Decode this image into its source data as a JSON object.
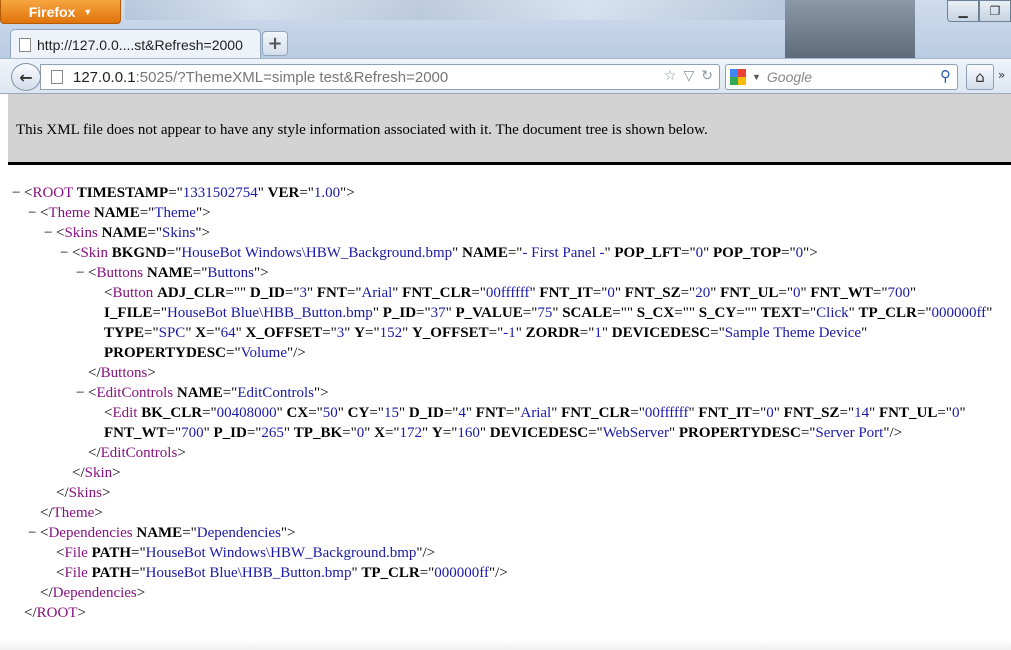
{
  "browser": {
    "app_button": "Firefox",
    "tab_title": "http://127.0.0....st&Refresh=2000",
    "new_tab_symbol": "+",
    "url_host": "127.0.0.1",
    "url_rest": ":5025/?ThemeXML=simple test&Refresh=2000",
    "search_placeholder": "Google",
    "icons": {
      "back": "back-arrow-icon",
      "bookmark": "star-icon",
      "dropdown": "history-dropdown-icon",
      "reload": "reload-icon",
      "search": "magnifier-icon",
      "home": "home-icon",
      "minimize": "minimize-icon",
      "maximize": "maximize-icon"
    },
    "colors": {
      "firefox_orange": "#e97d12",
      "tag": "#881280",
      "attr_value": "#1a1aa6"
    }
  },
  "xml_info": "This XML file does not appear to have any style information associated with it. The document tree is shown below.",
  "collapse_symbol": "−",
  "xml": {
    "root_open": {
      "tag": "ROOT",
      "attrs": [
        [
          "TIMESTAMP",
          "1331502754"
        ],
        [
          "VER",
          "1.00"
        ]
      ]
    },
    "theme_open": {
      "tag": "Theme",
      "attrs": [
        [
          "NAME",
          "Theme"
        ]
      ]
    },
    "skins_open": {
      "tag": "Skins",
      "attrs": [
        [
          "NAME",
          "Skins"
        ]
      ]
    },
    "skin_open": {
      "tag": "Skin",
      "attrs": [
        [
          "BKGND",
          "HouseBot Windows\\HBW_Background.bmp"
        ],
        [
          "NAME",
          "- First Panel -"
        ],
        [
          "POP_LFT",
          "0"
        ],
        [
          "POP_TOP",
          "0"
        ]
      ]
    },
    "buttons_open": {
      "tag": "Buttons",
      "attrs": [
        [
          "NAME",
          "Buttons"
        ]
      ]
    },
    "button_lines": [
      {
        "tag": "Button",
        "attrs": [
          [
            "ADJ_CLR",
            ""
          ],
          [
            "D_ID",
            "3"
          ],
          [
            "FNT",
            "Arial"
          ],
          [
            "FNT_CLR",
            "00ffffff"
          ],
          [
            "FNT_IT",
            "0"
          ],
          [
            "FNT_SZ",
            "20"
          ],
          [
            "FNT_UL",
            "0"
          ],
          [
            "FNT_WT",
            "700"
          ]
        ]
      },
      {
        "attrs": [
          [
            "I_FILE",
            "HouseBot Blue\\HBB_Button.bmp"
          ],
          [
            "P_ID",
            "37"
          ],
          [
            "P_VALUE",
            "75"
          ],
          [
            "SCALE",
            ""
          ],
          [
            "S_CX",
            ""
          ],
          [
            "S_CY",
            ""
          ],
          [
            "TEXT",
            "Click"
          ],
          [
            "TP_CLR",
            "000000ff"
          ]
        ]
      },
      {
        "attrs": [
          [
            "TYPE",
            "SPC"
          ],
          [
            "X",
            "64"
          ],
          [
            "X_OFFSET",
            "3"
          ],
          [
            "Y",
            "152"
          ],
          [
            "Y_OFFSET",
            "-1"
          ],
          [
            "ZORDR",
            "1"
          ],
          [
            "DEVICEDESC",
            "Sample Theme Device"
          ]
        ]
      },
      {
        "attrs": [
          [
            "PROPERTYDESC",
            "Volume"
          ]
        ],
        "close": "/>"
      }
    ],
    "buttons_close": "Buttons",
    "editcontrols_open": {
      "tag": "EditControls",
      "attrs": [
        [
          "NAME",
          "EditControls"
        ]
      ]
    },
    "edit_lines": [
      {
        "tag": "Edit",
        "attrs": [
          [
            "BK_CLR",
            "00408000"
          ],
          [
            "CX",
            "50"
          ],
          [
            "CY",
            "15"
          ],
          [
            "D_ID",
            "4"
          ],
          [
            "FNT",
            "Arial"
          ],
          [
            "FNT_CLR",
            "00ffffff"
          ],
          [
            "FNT_IT",
            "0"
          ],
          [
            "FNT_SZ",
            "14"
          ],
          [
            "FNT_UL",
            "0"
          ]
        ]
      },
      {
        "attrs": [
          [
            "FNT_WT",
            "700"
          ],
          [
            "P_ID",
            "265"
          ],
          [
            "TP_BK",
            "0"
          ],
          [
            "X",
            "172"
          ],
          [
            "Y",
            "160"
          ],
          [
            "DEVICEDESC",
            "WebServer"
          ],
          [
            "PROPERTYDESC",
            "Server Port"
          ]
        ],
        "close": "/>"
      }
    ],
    "editcontrols_close": "EditControls",
    "skin_close": "Skin",
    "skins_close": "Skins",
    "theme_close": "Theme",
    "dependencies_open": {
      "tag": "Dependencies",
      "attrs": [
        [
          "NAME",
          "Dependencies"
        ]
      ]
    },
    "file1": {
      "tag": "File",
      "attrs": [
        [
          "PATH",
          "HouseBot Windows\\HBW_Background.bmp"
        ]
      ],
      "close": "/>"
    },
    "file2": {
      "tag": "File",
      "attrs": [
        [
          "PATH",
          "HouseBot Blue\\HBB_Button.bmp"
        ],
        [
          "TP_CLR",
          "000000ff"
        ]
      ],
      "close": "/>"
    },
    "dependencies_close": "Dependencies",
    "root_close": "ROOT"
  }
}
